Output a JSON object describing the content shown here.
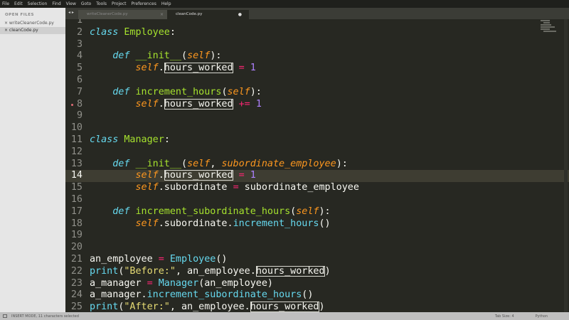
{
  "menu": [
    "File",
    "Edit",
    "Selection",
    "Find",
    "View",
    "Goto",
    "Tools",
    "Project",
    "Preferences",
    "Help"
  ],
  "sidebar": {
    "header": "OPEN FILES",
    "files": [
      {
        "name": "writeCleanerCode.py",
        "active": false
      },
      {
        "name": "cleanCode.py",
        "active": true
      }
    ]
  },
  "tabs": [
    {
      "label": "writeCleanerCode.py",
      "active": false
    },
    {
      "label": "cleanCode.py",
      "active": true
    }
  ],
  "editor": {
    "current_line": 14,
    "lines": [
      {
        "n": 1,
        "t": []
      },
      {
        "n": 2,
        "t": [
          [
            "class ",
            "kw"
          ],
          [
            "Employee",
            "cls"
          ],
          [
            ":",
            ""
          ]
        ]
      },
      {
        "n": 3,
        "t": []
      },
      {
        "n": 4,
        "t": [
          [
            "    ",
            ""
          ],
          [
            "def ",
            "kw"
          ],
          [
            "__init__",
            "fn"
          ],
          [
            "(",
            ""
          ],
          [
            "self",
            "arg"
          ],
          [
            "):",
            ""
          ]
        ]
      },
      {
        "n": 5,
        "t": [
          [
            "        ",
            ""
          ],
          [
            "self",
            "self"
          ],
          [
            ".",
            ""
          ],
          [
            "hours_worked",
            "sel"
          ],
          [
            " ",
            ""
          ],
          [
            "=",
            "op"
          ],
          [
            " ",
            ""
          ],
          [
            "1",
            "num2"
          ]
        ]
      },
      {
        "n": 6,
        "t": []
      },
      {
        "n": 7,
        "t": [
          [
            "    ",
            ""
          ],
          [
            "def ",
            "kw"
          ],
          [
            "increment_hours",
            "fn"
          ],
          [
            "(",
            ""
          ],
          [
            "self",
            "arg"
          ],
          [
            "):",
            ""
          ]
        ]
      },
      {
        "n": 8,
        "mark": true,
        "t": [
          [
            "        ",
            ""
          ],
          [
            "self",
            "self"
          ],
          [
            ".",
            ""
          ],
          [
            "hours_worked",
            "sel"
          ],
          [
            " ",
            ""
          ],
          [
            "+=",
            "op"
          ],
          [
            " ",
            ""
          ],
          [
            "1",
            "num2"
          ]
        ]
      },
      {
        "n": 9,
        "t": []
      },
      {
        "n": 10,
        "t": []
      },
      {
        "n": 11,
        "t": [
          [
            "class ",
            "kw"
          ],
          [
            "Manager",
            "cls"
          ],
          [
            ":",
            ""
          ]
        ]
      },
      {
        "n": 12,
        "t": []
      },
      {
        "n": 13,
        "t": [
          [
            "    ",
            ""
          ],
          [
            "def ",
            "kw"
          ],
          [
            "__init__",
            "fn"
          ],
          [
            "(",
            ""
          ],
          [
            "self",
            "arg"
          ],
          [
            ", ",
            ""
          ],
          [
            "subordinate_employee",
            "arg"
          ],
          [
            "):",
            ""
          ]
        ]
      },
      {
        "n": 14,
        "t": [
          [
            "        ",
            ""
          ],
          [
            "self",
            "self"
          ],
          [
            ".",
            ""
          ],
          [
            "hours_worked",
            "sel"
          ],
          [
            " ",
            ""
          ],
          [
            "=",
            "op"
          ],
          [
            " ",
            ""
          ],
          [
            "1",
            "num2"
          ]
        ]
      },
      {
        "n": 15,
        "t": [
          [
            "        ",
            ""
          ],
          [
            "self",
            "self"
          ],
          [
            ".subordinate ",
            ""
          ],
          [
            "=",
            "op"
          ],
          [
            " subordinate_employee",
            ""
          ]
        ]
      },
      {
        "n": 16,
        "t": []
      },
      {
        "n": 17,
        "t": [
          [
            "    ",
            ""
          ],
          [
            "def ",
            "kw"
          ],
          [
            "increment_subordinate_hours",
            "fn"
          ],
          [
            "(",
            ""
          ],
          [
            "self",
            "arg"
          ],
          [
            "):",
            ""
          ]
        ]
      },
      {
        "n": 18,
        "t": [
          [
            "        ",
            ""
          ],
          [
            "self",
            "self"
          ],
          [
            ".subordinate.",
            ""
          ],
          [
            "increment_hours",
            "bi"
          ],
          [
            "()",
            ""
          ]
        ]
      },
      {
        "n": 19,
        "t": []
      },
      {
        "n": 20,
        "t": []
      },
      {
        "n": 21,
        "t": [
          [
            "an_employee ",
            ""
          ],
          [
            "=",
            "op"
          ],
          [
            " ",
            ""
          ],
          [
            "Employee",
            "bi"
          ],
          [
            "()",
            ""
          ]
        ]
      },
      {
        "n": 22,
        "t": [
          [
            "print",
            "bi"
          ],
          [
            "(",
            ""
          ],
          [
            "\"Before:\"",
            "str"
          ],
          [
            ", an_employee.",
            ""
          ],
          [
            "hours_worked",
            "sel"
          ],
          [
            ")",
            ""
          ]
        ]
      },
      {
        "n": 23,
        "t": [
          [
            "a_manager ",
            ""
          ],
          [
            "=",
            "op"
          ],
          [
            " ",
            ""
          ],
          [
            "Manager",
            "bi"
          ],
          [
            "(an_employee)",
            ""
          ]
        ]
      },
      {
        "n": 24,
        "t": [
          [
            "a_manager.",
            ""
          ],
          [
            "increment_subordinate_hours",
            "bi"
          ],
          [
            "()",
            ""
          ]
        ]
      },
      {
        "n": 25,
        "t": [
          [
            "print",
            "bi"
          ],
          [
            "(",
            ""
          ],
          [
            "\"After:\"",
            "str"
          ],
          [
            ", an_employee.",
            ""
          ],
          [
            "hours_worked",
            "sel"
          ],
          [
            ")",
            ""
          ]
        ]
      }
    ]
  },
  "status": {
    "left": "INSERT MODE, 11 characters selected",
    "tab_size": "Tab Size: 4",
    "syntax": "Python"
  }
}
